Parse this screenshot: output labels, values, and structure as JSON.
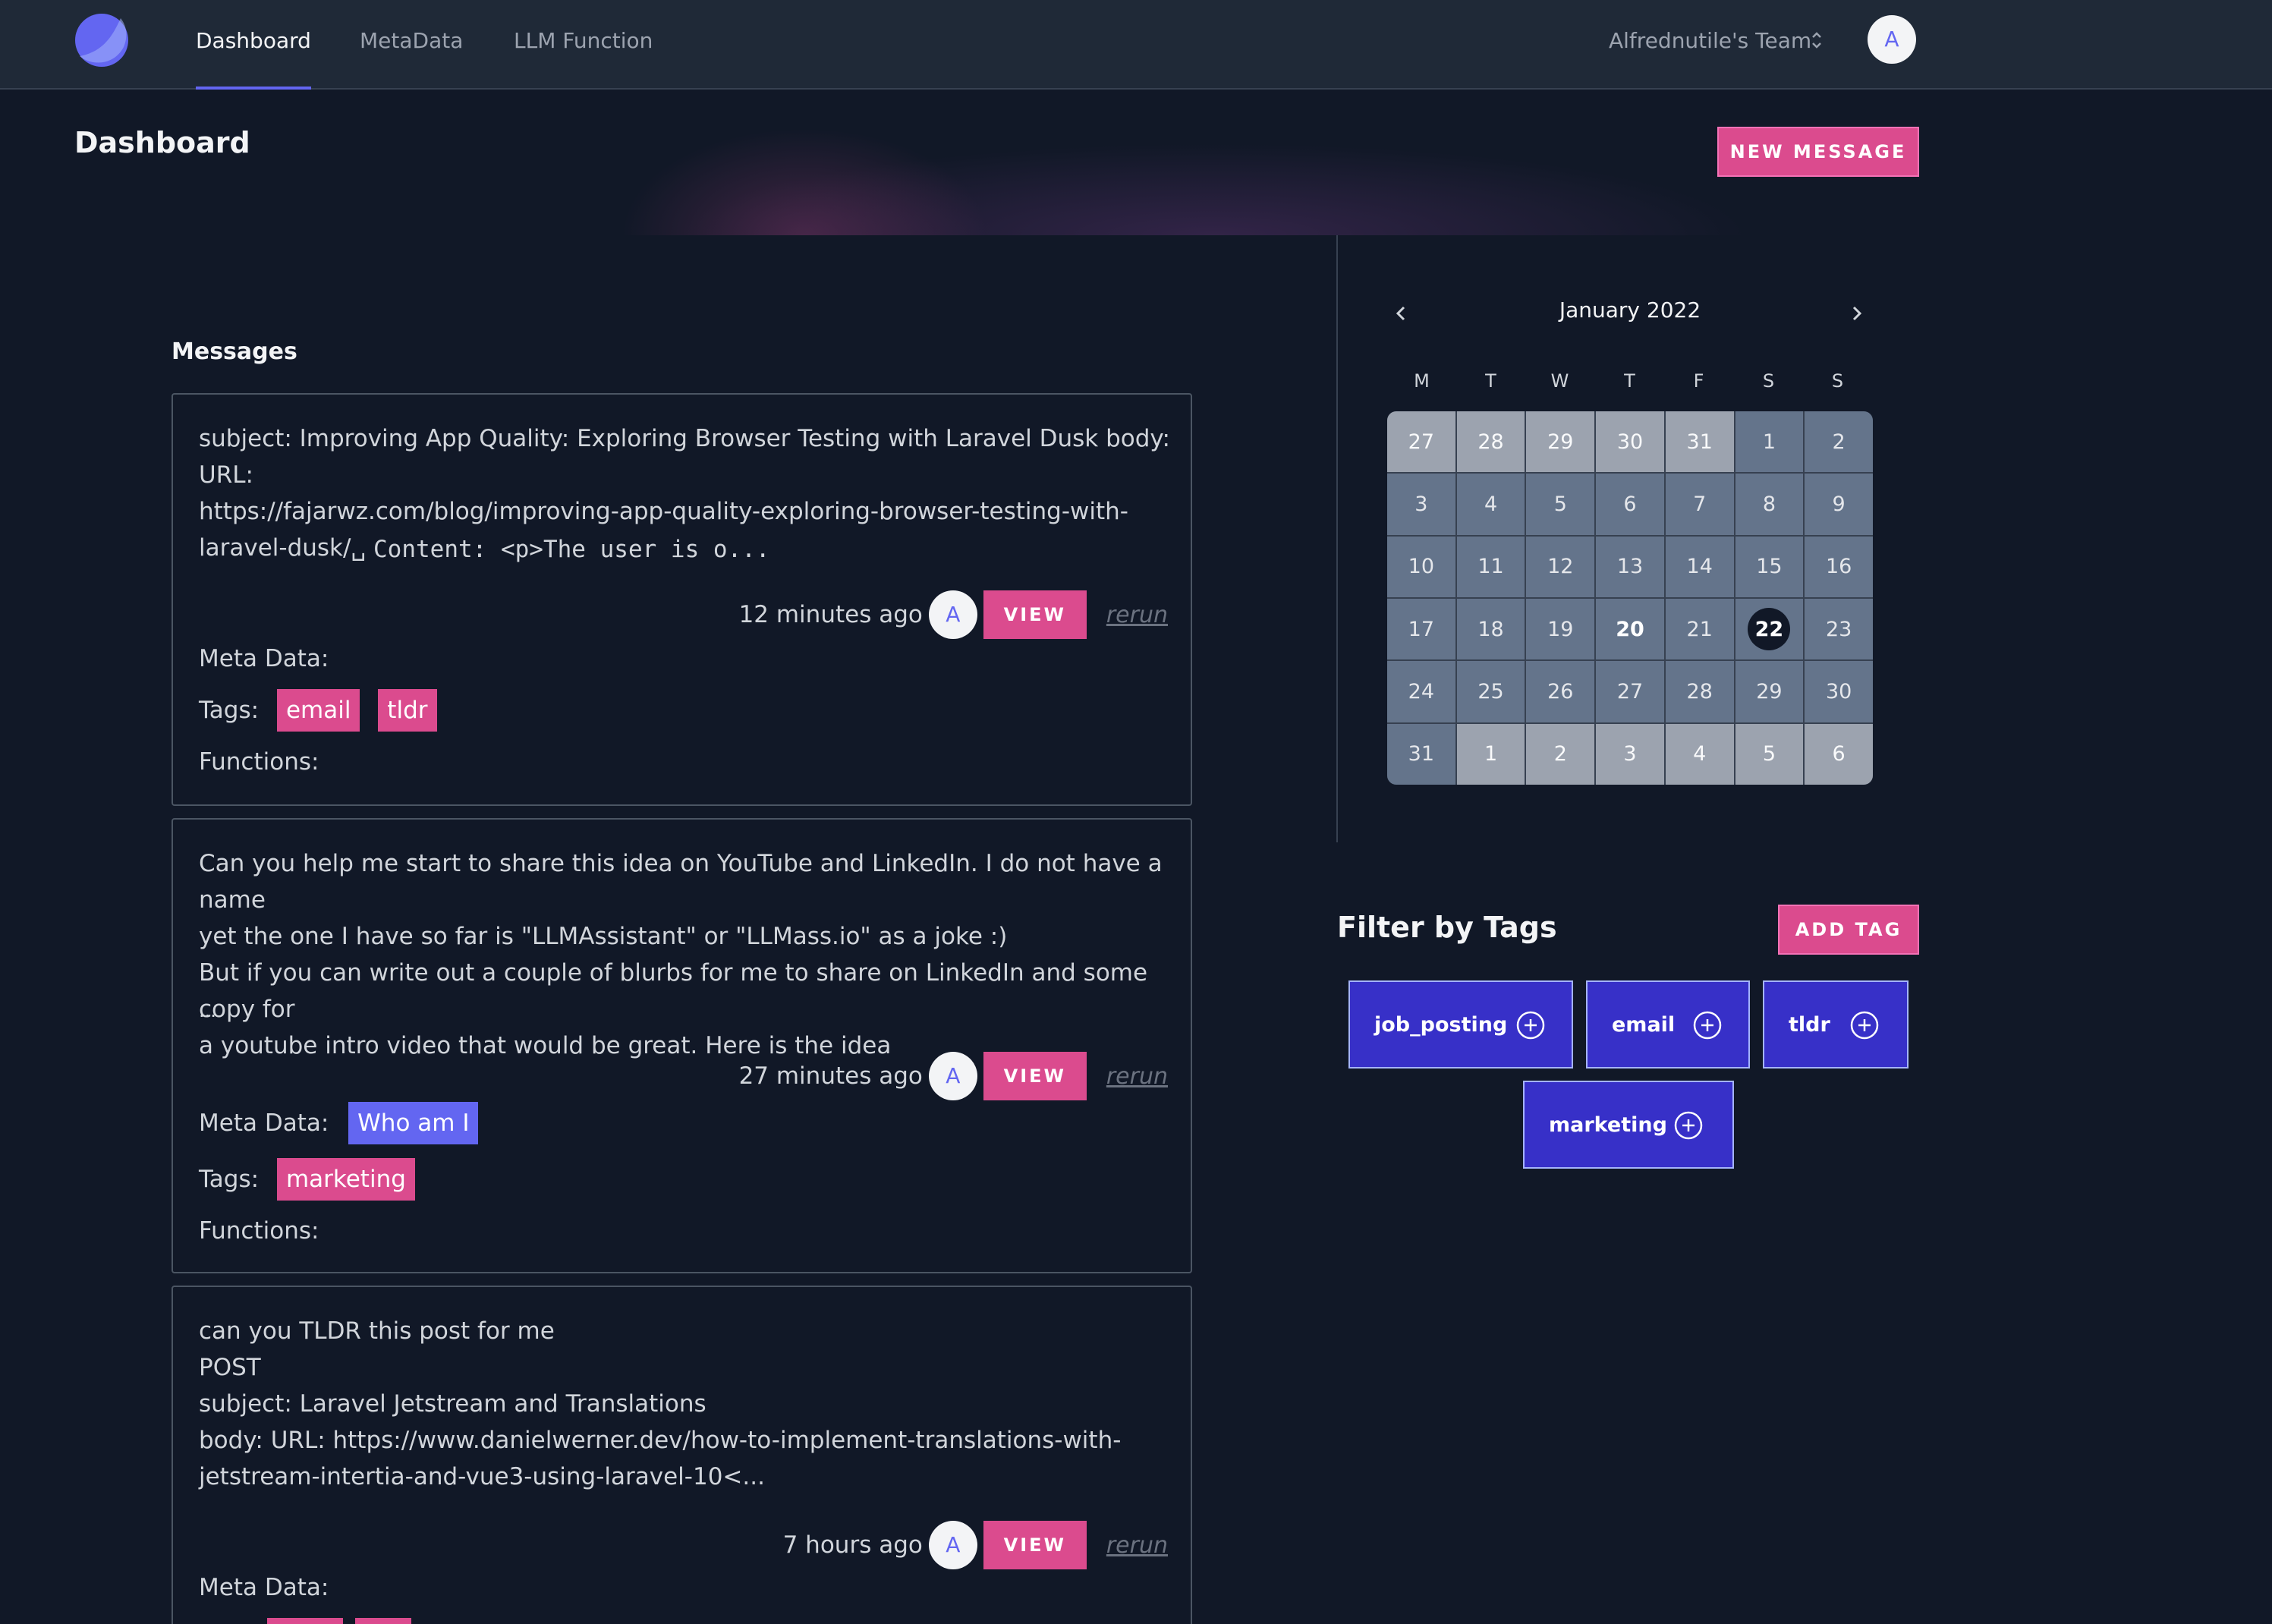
{
  "nav": {
    "links": [
      "Dashboard",
      "MetaData",
      "LLM Function"
    ],
    "team": "Alfrednutile's Team",
    "avatar_initial": "A",
    "accent": "#6366f1"
  },
  "header": {
    "title": "Dashboard",
    "new_message": "NEW MESSAGE"
  },
  "messages": {
    "title": "Messages",
    "meta_label": "Meta Data:",
    "tags_label": "Tags:",
    "functions_label": "Functions:",
    "view_label": "VIEW",
    "rerun_label": "rerun",
    "avatar_initial": "A",
    "items": [
      {
        "text": "subject: Improving App Quality: Exploring Browser Testing with Laravel Dusk body: URL:\nhttps://fajarwz.com/blog/improving-app-quality-exploring-browser-testing-with-\nlaravel-dusk/␣",
        "mono": "Content: <p>The user is o...",
        "time": "12 minutes ago",
        "tags": [
          "email",
          "tldr"
        ],
        "meta": []
      },
      {
        "text": "Can you help me start to share this idea on YouTube and LinkedIn. I do not have a name\nyet the one I have so far is \"LLMAssistant\" or \"LLMass.io\" as a joke :)\nBut if you can write out a couple of blurbs for me to share on LinkedIn and some copy for\na youtube intro video that would be great. Here is the idea",
        "ellipsis": "...",
        "time": "27 minutes ago",
        "tags": [
          "marketing"
        ],
        "meta": [
          "Who am I"
        ]
      },
      {
        "text": "can you TLDR this post for me\nPOST\nsubject: Laravel Jetstream and Translations\nbody: URL: https://www.danielwerner.dev/how-to-implement-translations-with-\njetstream-intertia-and-vue3-using-laravel-10<...",
        "time": "7 hours ago",
        "tags": [],
        "meta": []
      }
    ]
  },
  "calendar": {
    "title": "January 2022",
    "days_of_week": [
      "M",
      "T",
      "W",
      "T",
      "F",
      "S",
      "S"
    ],
    "weeks": [
      [
        [
          "27",
          "out"
        ],
        [
          "28",
          "out"
        ],
        [
          "29",
          "out"
        ],
        [
          "30",
          "out"
        ],
        [
          "31",
          "out"
        ],
        [
          "1",
          ""
        ],
        [
          "2",
          ""
        ]
      ],
      [
        [
          "3",
          ""
        ],
        [
          "4",
          ""
        ],
        [
          "5",
          ""
        ],
        [
          "6",
          ""
        ],
        [
          "7",
          ""
        ],
        [
          "8",
          ""
        ],
        [
          "9",
          ""
        ]
      ],
      [
        [
          "10",
          ""
        ],
        [
          "11",
          ""
        ],
        [
          "12",
          ""
        ],
        [
          "13",
          ""
        ],
        [
          "14",
          ""
        ],
        [
          "15",
          ""
        ],
        [
          "16",
          ""
        ]
      ],
      [
        [
          "17",
          ""
        ],
        [
          "18",
          ""
        ],
        [
          "19",
          ""
        ],
        [
          "20",
          "bold"
        ],
        [
          "21",
          ""
        ],
        [
          "22",
          "selected"
        ],
        [
          "23",
          ""
        ]
      ],
      [
        [
          "24",
          ""
        ],
        [
          "25",
          ""
        ],
        [
          "26",
          ""
        ],
        [
          "27",
          ""
        ],
        [
          "28",
          ""
        ],
        [
          "29",
          ""
        ],
        [
          "30",
          ""
        ]
      ],
      [
        [
          "31",
          ""
        ],
        [
          "1",
          "out"
        ],
        [
          "2",
          "out"
        ],
        [
          "3",
          "out"
        ],
        [
          "4",
          "out"
        ],
        [
          "5",
          "out"
        ],
        [
          "6",
          "out"
        ]
      ]
    ]
  },
  "filter": {
    "title": "Filter by Tags",
    "add_tag": "ADD TAG",
    "tags": [
      "job_posting",
      "email",
      "tldr",
      "marketing"
    ]
  },
  "colors": {
    "pink": "#db4b8e",
    "indigo": "#6366f1",
    "tag_blue": "#3730c8"
  }
}
